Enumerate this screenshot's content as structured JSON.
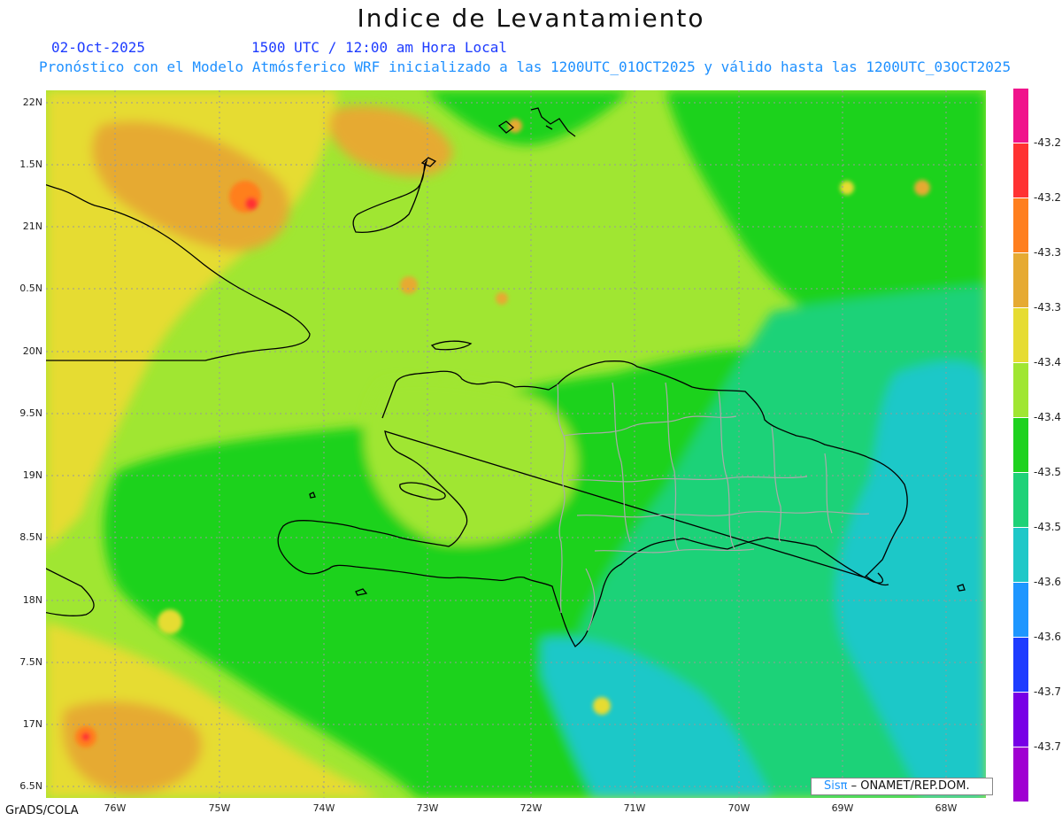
{
  "title": "Indice de Levantamiento",
  "subtitle_date": "02-Oct-2025",
  "subtitle_time": "1500 UTC / 12:00 am Hora Local",
  "subtitle_model": "Pronóstico con el Modelo Atmósferico WRF inicializado a las 1200UTC_01OCT2025 y válido hasta las  1200UTC_03OCT2025",
  "credit": "GrADS/COLA",
  "stamp": {
    "logo": "Sisπ",
    "text": " – ONAMET/REP.DOM."
  },
  "lat_labels": [
    "22N",
    "1.5N",
    "21N",
    "0.5N",
    "20N",
    "9.5N",
    "19N",
    "8.5N",
    "18N",
    "7.5N",
    "17N",
    "6.5N"
  ],
  "lon_labels": [
    "76W",
    "75W",
    "74W",
    "73W",
    "72W",
    "71W",
    "70W",
    "69W",
    "68W"
  ],
  "colorbar": {
    "labels": [
      "-43.2",
      "-43.2",
      "-43.3",
      "-43.3",
      "-43.4",
      "-43.4",
      "-43.5",
      "-43.5",
      "-43.6",
      "-43.6",
      "-43.7",
      "-43.7"
    ],
    "colors": [
      "#f0148c",
      "#ff3232",
      "#ff7f1e",
      "#e6aa32",
      "#e6dc32",
      "#a0e632",
      "#1ed21e",
      "#1ed278",
      "#1ec8c8",
      "#1e96ff",
      "#1e3cff",
      "#7800e6",
      "#a000d2"
    ]
  },
  "palette": {
    "orange": "#e6aa32",
    "yellow": "#e6dc32",
    "light_green": "#a0e632",
    "green": "#1ed21e",
    "sea_green": "#1ed278",
    "cyan": "#1ec8c8",
    "red": "#ff3232"
  }
}
